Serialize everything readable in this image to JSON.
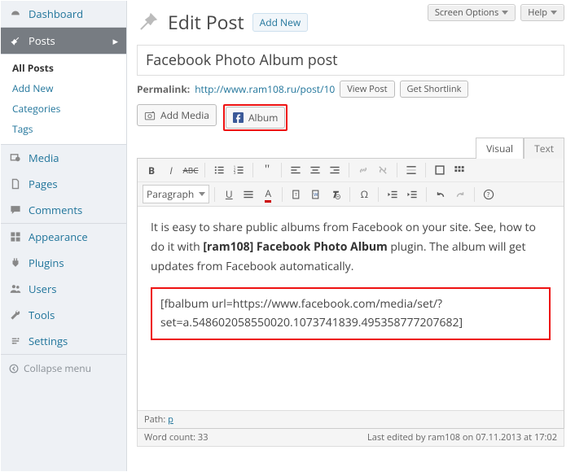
{
  "top_buttons": {
    "screen_options": "Screen Options",
    "help": "Help"
  },
  "sidebar": {
    "items": [
      {
        "id": "dashboard",
        "label": "Dashboard",
        "icon": "dashboard-icon"
      },
      {
        "id": "posts",
        "label": "Posts",
        "icon": "pin-icon"
      },
      {
        "id": "media",
        "label": "Media",
        "icon": "media-icon"
      },
      {
        "id": "pages",
        "label": "Pages",
        "icon": "page-icon"
      },
      {
        "id": "comments",
        "label": "Comments",
        "icon": "comment-icon"
      },
      {
        "id": "appearance",
        "label": "Appearance",
        "icon": "appearance-icon"
      },
      {
        "id": "plugins",
        "label": "Plugins",
        "icon": "plugin-icon"
      },
      {
        "id": "users",
        "label": "Users",
        "icon": "users-icon"
      },
      {
        "id": "tools",
        "label": "Tools",
        "icon": "tools-icon"
      },
      {
        "id": "settings",
        "label": "Settings",
        "icon": "settings-icon"
      }
    ],
    "posts_sub": [
      {
        "id": "all",
        "label": "All Posts",
        "current": true
      },
      {
        "id": "new",
        "label": "Add New"
      },
      {
        "id": "cat",
        "label": "Categories"
      },
      {
        "id": "tag",
        "label": "Tags"
      }
    ],
    "collapse_label": "Collapse menu"
  },
  "page": {
    "heading": "Edit Post",
    "add_new": "Add New",
    "title": "Facebook Photo Album post",
    "permalink_label": "Permalink:",
    "permalink_url": "http://www.ram108.ru/post/10",
    "view_post": "View Post",
    "get_shortlink": "Get Shortlink",
    "add_media": "Add Media",
    "album": "Album"
  },
  "editor": {
    "tabs": {
      "visual": "Visual",
      "text": "Text"
    },
    "paragraph_selector": "Paragraph",
    "content_html": "It is easy to share public albums from Facebook on your site. See, how to do it with <b>[ram108] Facebook Photo Album</b> plugin. The album will get updates from Facebook automatically.",
    "shortcode": "[fbalbum url=https://www.facebook.com/media/set/?set=a.548602058550020.1073741839.495358777207682]",
    "path_label": "Path:",
    "path_value": "p"
  },
  "footer": {
    "word_count_label": "Word count:",
    "word_count": "33",
    "last_edited": "Last edited by ram108 on 07.11.2013 at 17:02"
  }
}
